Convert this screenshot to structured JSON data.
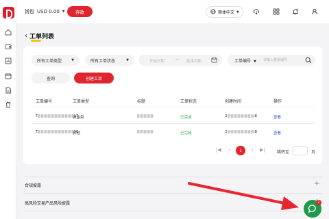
{
  "topbar": {
    "wallet_label": "钱包",
    "wallet_amount": "USD 0.00",
    "deposit_label": "存款",
    "language": "简体中文"
  },
  "page": {
    "title": "工单列表"
  },
  "filters": {
    "ticket_type": "所有工单类型",
    "ticket_status": "所有工单状态",
    "start_date_placeholder": "开始日期",
    "date_separator": "—",
    "end_date_placeholder": "结束日期",
    "search_field": "工单编号",
    "search_placeholder": "请输入税批编号"
  },
  "actions": {
    "query_label": "查询",
    "create_label": "创建工单"
  },
  "table": {
    "columns": [
      "工单编号",
      "工单类型",
      "标题",
      "工单状态",
      "创建时间",
      "操作"
    ],
    "rows": [
      {
        "id_prefix": "T",
        "id_suffix": "17",
        "type": "资金类",
        "status": "已完成",
        "created_prefix": "2",
        "created_suffix": "8",
        "action": "查看"
      },
      {
        "id_prefix": "T",
        "id_suffix": "30",
        "type": "其他",
        "status": "已完成",
        "created_prefix": "2",
        "created_suffix": "8",
        "action": "查看"
      }
    ]
  },
  "pagination": {
    "first": "|◀",
    "prev": "‹",
    "current": "1",
    "next": "›",
    "last": "▶|",
    "goto_label": "跳转至",
    "page_label": "页"
  },
  "faq": {
    "items": [
      "合规披露",
      "高风险交易产品风险披露"
    ]
  },
  "chat": {
    "badge": "1"
  },
  "icons": {
    "sidebar": [
      "home-icon",
      "wallet-icon",
      "chart-icon",
      "box-icon",
      "document-icon",
      "trash-icon"
    ],
    "topbar": [
      "globe-icon",
      "download-icon",
      "grid-icon",
      "bell-icon",
      "user-icon"
    ]
  },
  "colors": {
    "brand_red": "#e0252f",
    "status_green": "#23a547",
    "link_blue": "#2b59d6",
    "chat_green": "#1f9a4a",
    "title_underline": "#f5c518"
  }
}
